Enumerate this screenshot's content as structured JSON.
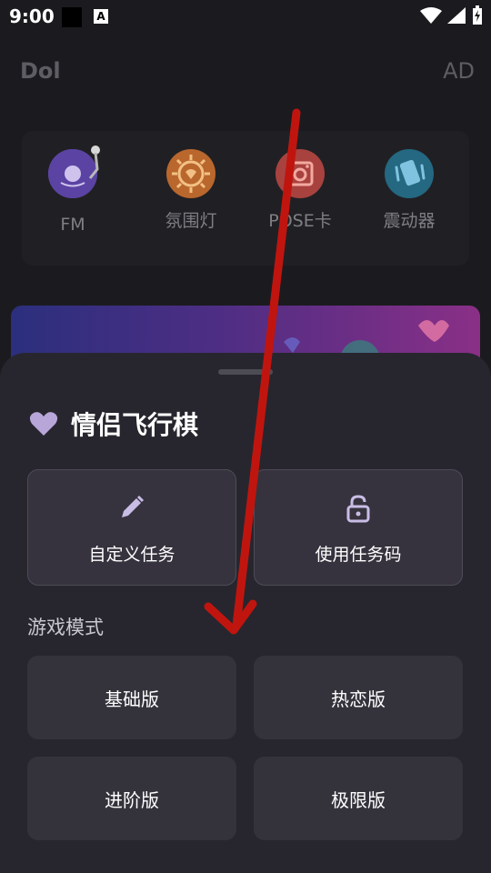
{
  "status_bar": {
    "time": "9:00",
    "a_badge": "A"
  },
  "app": {
    "logo": "Dol",
    "ad": "AD"
  },
  "features": [
    {
      "label": "FM",
      "icon": "fm-disc-icon"
    },
    {
      "label": "氛围灯",
      "icon": "lamp-icon"
    },
    {
      "label": "POSE卡",
      "icon": "camera-icon"
    },
    {
      "label": "震动器",
      "icon": "vibrate-icon"
    }
  ],
  "sheet": {
    "title": "情侣飞行棋",
    "actions": [
      {
        "label": "自定义任务",
        "icon": "pencil-icon"
      },
      {
        "label": "使用任务码",
        "icon": "lock-icon"
      }
    ],
    "mode_heading": "游戏模式",
    "modes": [
      "基础版",
      "热恋版",
      "进阶版",
      "极限版"
    ]
  },
  "colors": {
    "background": "#1b1b1f",
    "sheet": "#27262e",
    "accent_heart": "#b8a6d9",
    "annotation_arrow": "#c0150f"
  }
}
